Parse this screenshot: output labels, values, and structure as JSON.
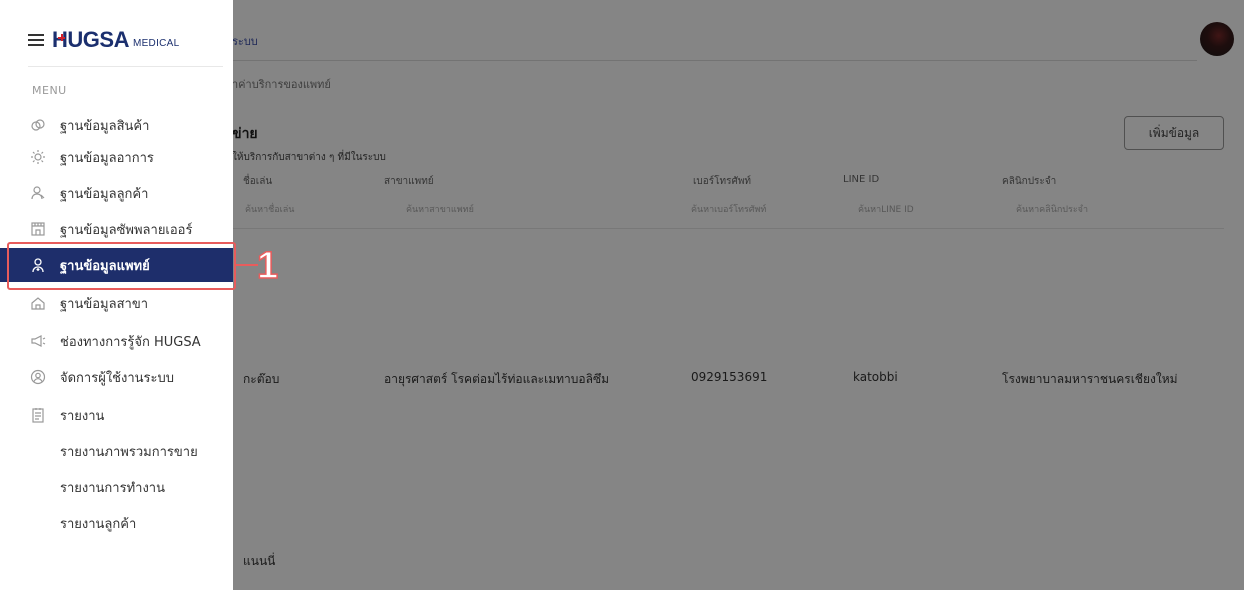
{
  "app": {
    "logo_main": "HUGSA",
    "logo_sub": "MEDICAL"
  },
  "main": {
    "breadcrumb": "ระบบ",
    "sub_breadcrumb": "าค่าบริการของแพทย์",
    "section_title": "ข่าย",
    "section_subtitle": "ให้บริการกับสาขาต่าง ๆ ที่มีในระบบ",
    "add_button": "เพิ่มข้อมูล",
    "columns": [
      "ชื่อเล่น",
      "สาขาแพทย์",
      "เบอร์โทรศัพท์",
      "LINE ID",
      "คลินิกประจำ"
    ],
    "filters": [
      "ค้นหาชื่อเล่น",
      "ค้นหาสาขาแพทย์",
      "ค้นหาเบอร์โทรศัพท์",
      "ค้นหาLINE ID",
      "ค้นหาคลินิกประจำ"
    ],
    "rows": [
      [
        "กะต๊อบ",
        "อายุรศาสตร์ โรคต่อมไร้ท่อและเมทาบอลิซึม",
        "0929153691",
        "katobbi",
        "โรงพยาบาลมหาราชนครเชียงใหม่"
      ]
    ],
    "footer_text": "แนนนี่"
  },
  "sidebar": {
    "menu_label": "MENU",
    "items": [
      {
        "label": "ฐานข้อมูลสินค้า",
        "icon": "products-icon",
        "active": false
      },
      {
        "label": "ฐานข้อมูลอาการ",
        "icon": "symptoms-icon",
        "active": false
      },
      {
        "label": "ฐานข้อมูลลูกค้า",
        "icon": "customer-icon",
        "active": false
      },
      {
        "label": "ฐานข้อมูลซัพพลายเออร์",
        "icon": "supplier-icon",
        "active": false
      },
      {
        "label": "ฐานข้อมูลแพทย์",
        "icon": "doctor-icon",
        "active": true
      },
      {
        "label": "ฐานข้อมูลสาขา",
        "icon": "home-icon",
        "active": false
      },
      {
        "label": "ช่องทางการรู้จัก HUGSA",
        "icon": "megaphone-icon",
        "active": false
      },
      {
        "label": "จัดการผู้ใช้งานระบบ",
        "icon": "user-circle-icon",
        "active": false
      },
      {
        "label": "รายงาน",
        "icon": "report-icon",
        "active": false
      }
    ],
    "sub_items": [
      "รายงานภาพรวมการขาย",
      "รายงานการทำงาน",
      "รายงานลูกค้า"
    ]
  },
  "annotation": {
    "callout_number": "1",
    "color": "#e85c5c"
  },
  "colors": {
    "active_bg": "#1e2e6b",
    "brand": "#1b2f6e",
    "brand_accent": "#d3202a"
  }
}
